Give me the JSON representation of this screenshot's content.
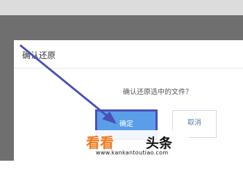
{
  "dialog": {
    "title": "确认还原",
    "message": "确认还原选中的文件？",
    "confirm_label": "确定",
    "cancel_label": "取消"
  },
  "watermark": {
    "brand_orange": "看看",
    "brand_black": "头条",
    "url": "www.kankantoutiao.com"
  },
  "colors": {
    "overlay": "#6f6f6f",
    "annotation_arrow": "#4b4fb8",
    "confirm_button": "#5a9ee8",
    "brand_orange": "#f07a20"
  }
}
